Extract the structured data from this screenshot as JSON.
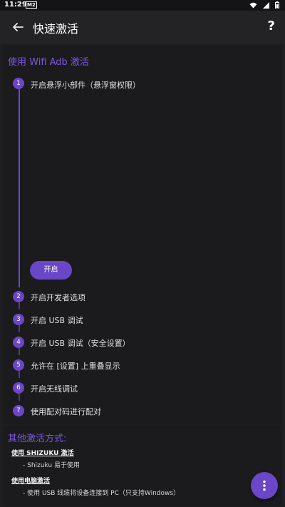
{
  "status_bar": {
    "time": "11:29",
    "badge": "M2"
  },
  "app_bar": {
    "title": "快速激活",
    "help_label": "?"
  },
  "wifi_section": {
    "title": "使用 Wifi Adb 激活",
    "steps": [
      {
        "num": "1",
        "label": "开启悬浮小部件（悬浮窗权限）"
      },
      {
        "num": "2",
        "label": "开启开发者选项"
      },
      {
        "num": "3",
        "label": "开启 USB 调试"
      },
      {
        "num": "4",
        "label": "开启 USB 调试（安全设置）"
      },
      {
        "num": "5",
        "label": "允许在 [设置] 上重叠显示"
      },
      {
        "num": "6",
        "label": "开启无线调试"
      },
      {
        "num": "7",
        "label": "使用配对码进行配对"
      }
    ],
    "open_button": "开启"
  },
  "other_methods": {
    "title": "其他激活方式:",
    "methods": [
      {
        "title": "使用 SHIZUKU 激活",
        "desc": "- Shizuku 易于使用"
      },
      {
        "title": "使用电脑激活",
        "desc": "- 使用 USB 线缆将设备连接到 PC（只支持Windows）"
      }
    ]
  },
  "colors": {
    "accent": "#6b46c8",
    "section_title": "#7d57e0",
    "background": "#1f1f22"
  },
  "icons": {
    "back": "arrow-left-icon",
    "fab": "more-vert-icon"
  }
}
